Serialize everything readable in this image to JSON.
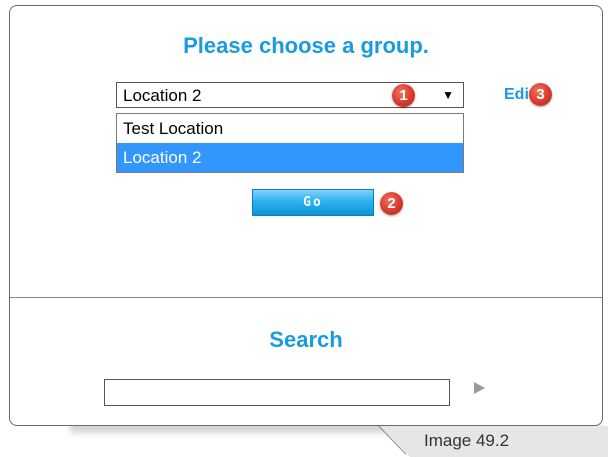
{
  "header": {
    "title": "Please choose a group."
  },
  "group_select": {
    "selected": "Location 2",
    "arrow_icon": "▼",
    "options": [
      {
        "label": "Test Location",
        "selected": false
      },
      {
        "label": "Location 2",
        "selected": true
      }
    ]
  },
  "badges": {
    "dropdown": "1",
    "go": "2",
    "edit": "3"
  },
  "edit_link": {
    "label": "Edit"
  },
  "go_button": {
    "label": "Go"
  },
  "search": {
    "title": "Search",
    "value": ""
  },
  "caption": {
    "text": "Image 49.2"
  },
  "colors": {
    "accent": "#1a9bde",
    "badge": "#d8392b",
    "selected_option": "#3297fd",
    "button": "#2db2ef"
  }
}
